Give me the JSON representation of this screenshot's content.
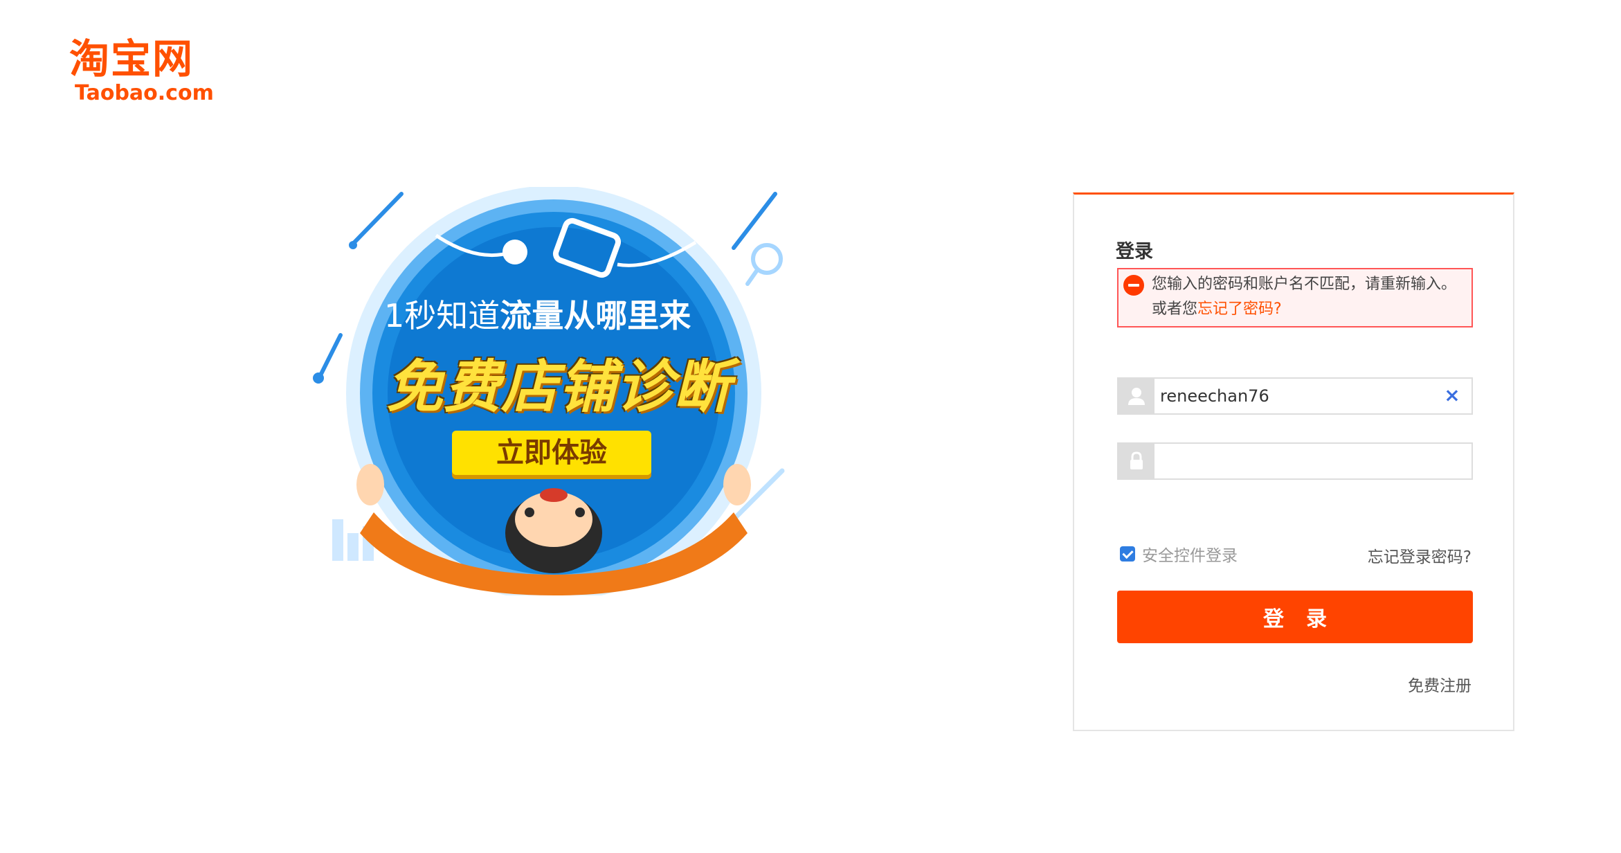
{
  "logo": {
    "cn": "淘宝网",
    "en": "Taobao.com"
  },
  "banner": {
    "line1_thin": "1秒知道",
    "line1_bold": "流量从哪里来",
    "headline": "免费店铺诊断",
    "cta": "立即体验"
  },
  "login": {
    "title": "登录",
    "error": {
      "message": "您输入的密码和账户名不匹配，请重新输入。或者您",
      "link": "忘记了密码?"
    },
    "username": {
      "value": "reneechan76",
      "icon": "user-icon",
      "clear_icon": "close-icon"
    },
    "password": {
      "value": "",
      "icon": "lock-icon"
    },
    "secure_control": {
      "label": "安全控件登录",
      "checked": true
    },
    "forgot_password": "忘记登录密码?",
    "submit": "登录",
    "register": "免费注册"
  },
  "colors": {
    "brand": "#ff5000",
    "button": "#ff4400",
    "error_border": "#ff5555",
    "banner_blue": "#1a8be0",
    "cta_yellow": "#ffe100"
  }
}
